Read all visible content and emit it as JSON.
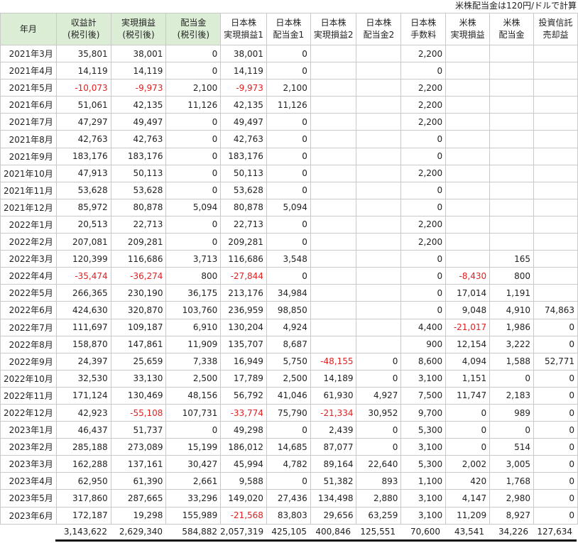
{
  "note": "米株配当金は120円/ドルで計算",
  "headers": [
    {
      "l1": "年月",
      "l2": ""
    },
    {
      "l1": "収益計",
      "l2": "(税引後)"
    },
    {
      "l1": "実現損益",
      "l2": "(税引後)"
    },
    {
      "l1": "配当金",
      "l2": "(税引後)"
    },
    {
      "l1": "日本株",
      "l2": "実現損益1"
    },
    {
      "l1": "日本株",
      "l2": "配当金1"
    },
    {
      "l1": "日本株",
      "l2": "実現損益2"
    },
    {
      "l1": "日本株",
      "l2": "配当金2"
    },
    {
      "l1": "日本株",
      "l2": "手数料"
    },
    {
      "l1": "米株",
      "l2": "実現損益"
    },
    {
      "l1": "米株",
      "l2": "配当金"
    },
    {
      "l1": "投資信託",
      "l2": "売却益"
    }
  ],
  "rows": [
    [
      "2021年3月",
      "35,801",
      "38,001",
      "0",
      "38,001",
      "0",
      "",
      "",
      "2,200",
      "",
      "",
      ""
    ],
    [
      "2021年4月",
      "14,119",
      "14,119",
      "0",
      "14,119",
      "0",
      "",
      "",
      "0",
      "",
      "",
      ""
    ],
    [
      "2021年5月",
      "-10,073",
      "-9,973",
      "2,100",
      "-9,973",
      "2,100",
      "",
      "",
      "2,200",
      "",
      "",
      ""
    ],
    [
      "2021年6月",
      "51,061",
      "42,135",
      "11,126",
      "42,135",
      "11,126",
      "",
      "",
      "2,200",
      "",
      "",
      ""
    ],
    [
      "2021年7月",
      "47,297",
      "49,497",
      "0",
      "49,497",
      "0",
      "",
      "",
      "2,200",
      "",
      "",
      ""
    ],
    [
      "2021年8月",
      "42,763",
      "42,763",
      "0",
      "42,763",
      "0",
      "",
      "",
      "0",
      "",
      "",
      ""
    ],
    [
      "2021年9月",
      "183,176",
      "183,176",
      "0",
      "183,176",
      "0",
      "",
      "",
      "0",
      "",
      "",
      ""
    ],
    [
      "2021年10月",
      "47,913",
      "50,113",
      "0",
      "50,113",
      "0",
      "",
      "",
      "2,200",
      "",
      "",
      ""
    ],
    [
      "2021年11月",
      "53,628",
      "53,628",
      "0",
      "53,628",
      "0",
      "",
      "",
      "0",
      "",
      "",
      ""
    ],
    [
      "2021年12月",
      "85,972",
      "80,878",
      "5,094",
      "80,878",
      "5,094",
      "",
      "",
      "0",
      "",
      "",
      ""
    ],
    [
      "2022年1月",
      "20,513",
      "22,713",
      "0",
      "22,713",
      "0",
      "",
      "",
      "2,200",
      "",
      "",
      ""
    ],
    [
      "2022年2月",
      "207,081",
      "209,281",
      "0",
      "209,281",
      "0",
      "",
      "",
      "2,200",
      "",
      "",
      ""
    ],
    [
      "2022年3月",
      "120,399",
      "116,686",
      "3,713",
      "116,686",
      "3,548",
      "",
      "",
      "0",
      "",
      "165",
      ""
    ],
    [
      "2022年4月",
      "-35,474",
      "-36,274",
      "800",
      "-27,844",
      "0",
      "",
      "",
      "0",
      "-8,430",
      "800",
      ""
    ],
    [
      "2022年5月",
      "266,365",
      "230,190",
      "36,175",
      "213,176",
      "34,984",
      "",
      "",
      "0",
      "17,014",
      "1,191",
      ""
    ],
    [
      "2022年6月",
      "424,630",
      "320,870",
      "103,760",
      "236,959",
      "98,850",
      "",
      "",
      "0",
      "9,048",
      "4,910",
      "74,863"
    ],
    [
      "2022年7月",
      "111,697",
      "109,187",
      "6,910",
      "130,204",
      "4,924",
      "",
      "",
      "4,400",
      "-21,017",
      "1,986",
      "0"
    ],
    [
      "2022年8月",
      "158,870",
      "147,861",
      "11,909",
      "135,707",
      "8,687",
      "",
      "",
      "900",
      "12,154",
      "3,222",
      "0"
    ],
    [
      "2022年9月",
      "24,397",
      "25,659",
      "7,338",
      "16,949",
      "5,750",
      "-48,155",
      "0",
      "8,600",
      "4,094",
      "1,588",
      "52,771"
    ],
    [
      "2022年10月",
      "32,530",
      "33,130",
      "2,500",
      "17,789",
      "2,500",
      "14,189",
      "0",
      "3,100",
      "1,151",
      "0",
      "0"
    ],
    [
      "2022年11月",
      "171,124",
      "130,469",
      "48,156",
      "56,792",
      "41,046",
      "61,930",
      "4,927",
      "7,500",
      "11,747",
      "2,183",
      "0"
    ],
    [
      "2022年12月",
      "42,923",
      "-55,108",
      "107,731",
      "-33,774",
      "75,790",
      "-21,334",
      "30,952",
      "9,700",
      "0",
      "989",
      "0"
    ],
    [
      "2023年1月",
      "46,437",
      "51,737",
      "0",
      "49,298",
      "0",
      "2,439",
      "0",
      "5,300",
      "0",
      "0",
      "0"
    ],
    [
      "2023年2月",
      "285,188",
      "273,089",
      "15,199",
      "186,012",
      "14,685",
      "87,077",
      "0",
      "3,100",
      "0",
      "514",
      "0"
    ],
    [
      "2023年3月",
      "162,288",
      "137,161",
      "30,427",
      "45,994",
      "4,782",
      "89,164",
      "22,640",
      "5,300",
      "2,002",
      "3,005",
      "0"
    ],
    [
      "2023年4月",
      "62,950",
      "61,390",
      "2,661",
      "9,588",
      "0",
      "51,382",
      "893",
      "1,100",
      "420",
      "1,768",
      "0"
    ],
    [
      "2023年5月",
      "317,860",
      "287,665",
      "33,296",
      "149,020",
      "27,436",
      "134,498",
      "2,880",
      "3,100",
      "4,147",
      "2,980",
      "0"
    ],
    [
      "2023年6月",
      "172,187",
      "19,298",
      "155,989",
      "-21,568",
      "83,803",
      "29,656",
      "63,259",
      "3,100",
      "11,209",
      "8,927",
      "0"
    ]
  ],
  "totals": [
    "3,143,622",
    "2,629,340",
    "584,882",
    "2,057,319",
    "425,105",
    "400,846",
    "125,551",
    "70,600",
    "43,541",
    "34,226",
    "127,634"
  ],
  "colors": {
    "header_highlight": "#dcedd6",
    "negative": "#e02020",
    "border": "#c9c9c9"
  }
}
